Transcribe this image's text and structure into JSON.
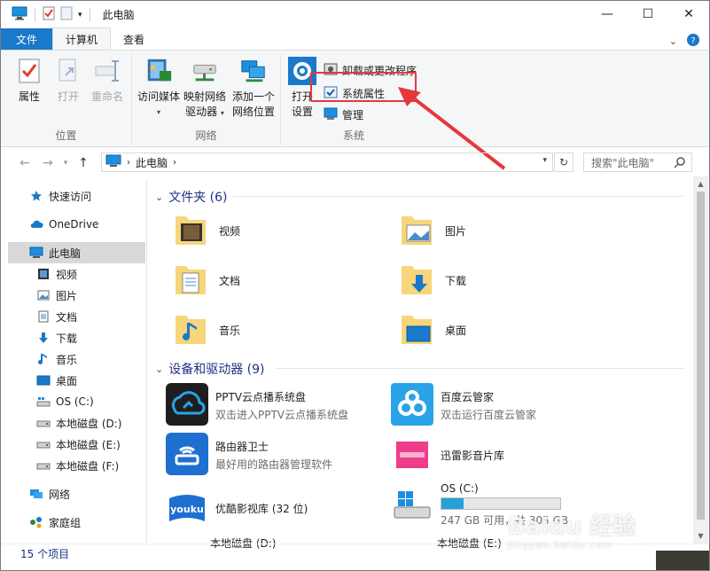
{
  "window": {
    "title": "此电脑"
  },
  "tabs": {
    "file": "文件",
    "computer": "计算机",
    "view": "查看"
  },
  "ribbon": {
    "location": {
      "label": "位置",
      "properties": "属性",
      "open": "打开",
      "rename": "重命名"
    },
    "network": {
      "label": "网络",
      "access_media": "访问媒体",
      "map_drive_l1": "映射网络",
      "map_drive_l2": "驱动器",
      "add_location_l1": "添加一个",
      "add_location_l2": "网络位置"
    },
    "system": {
      "label": "系统",
      "open_settings_l1": "打开",
      "open_settings_l2": "设置",
      "uninstall": "卸载或更改程序",
      "system_properties": "系统属性",
      "manage": "管理"
    }
  },
  "address": {
    "path": "此电脑",
    "search_placeholder": "搜索\"此电脑\""
  },
  "nav": {
    "items": [
      {
        "label": "快速访问",
        "icon": "star-icon"
      },
      {
        "label": "OneDrive",
        "icon": "cloud-icon"
      },
      {
        "label": "此电脑",
        "icon": "computer-icon"
      },
      {
        "label": "视频",
        "icon": "video-icon"
      },
      {
        "label": "图片",
        "icon": "picture-icon"
      },
      {
        "label": "文档",
        "icon": "document-icon"
      },
      {
        "label": "下载",
        "icon": "download-icon"
      },
      {
        "label": "音乐",
        "icon": "music-icon"
      },
      {
        "label": "桌面",
        "icon": "desktop-icon"
      },
      {
        "label": "OS (C:)",
        "icon": "drive-icon"
      },
      {
        "label": "本地磁盘 (D:)",
        "icon": "drive-icon"
      },
      {
        "label": "本地磁盘 (E:)",
        "icon": "drive-icon"
      },
      {
        "label": "本地磁盘 (F:)",
        "icon": "drive-icon"
      },
      {
        "label": "网络",
        "icon": "network-icon"
      },
      {
        "label": "家庭组",
        "icon": "homegroup-icon"
      }
    ]
  },
  "content": {
    "folders_header": "文件夹 (6)",
    "folders": [
      "视频",
      "图片",
      "文档",
      "下载",
      "音乐",
      "桌面"
    ],
    "devices_header": "设备和驱动器 (9)",
    "devices": [
      {
        "name": "PPTV云点播系统盘",
        "sub": "双击进入PPTV云点播系统盘"
      },
      {
        "name": "百度云管家",
        "sub": "双击运行百度云管家"
      },
      {
        "name": "路由器卫士",
        "sub": "最好用的路由器管理软件"
      },
      {
        "name": "迅雷影音片库",
        "sub": ""
      },
      {
        "name": "优酷影视库 (32 位)",
        "sub": ""
      },
      {
        "name": "OS (C:)",
        "sub": "247 GB 可用，共 305 GB",
        "used_fraction": 0.19
      },
      {
        "name": "本地磁盘 (D:)",
        "sub": ""
      },
      {
        "name": "本地磁盘 (E:)",
        "sub": ""
      }
    ]
  },
  "status": {
    "count": "15 个项目"
  },
  "watermark": {
    "brand": "Baidu 经验",
    "url": "jingyan.baidu.com"
  },
  "colors": {
    "accent": "#1979ca",
    "annotation": "#e5383b",
    "selection": "#d9d9d9"
  }
}
